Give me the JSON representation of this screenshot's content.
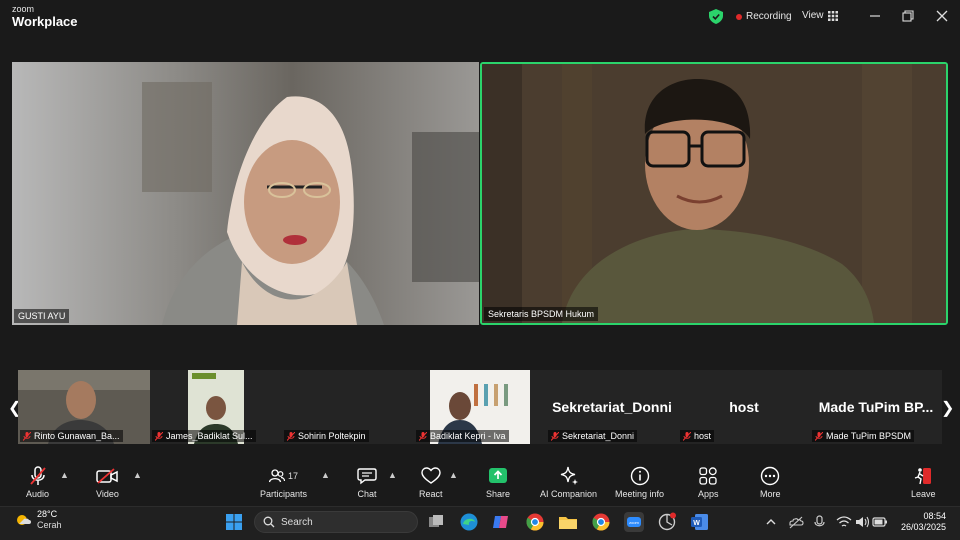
{
  "app": {
    "brand_small": "zoom",
    "brand_big": "Workplace"
  },
  "header": {
    "recording_label": "Recording",
    "view_label": "View"
  },
  "main_videos": [
    {
      "name": "GUSTI AYU"
    },
    {
      "name": "Sekretaris BPSDM Hukum",
      "active_speaker": true
    }
  ],
  "thumbnails": [
    {
      "label": "Rinto Gunawan_Ba..."
    },
    {
      "label": "James_Badiklat Sul..."
    },
    {
      "label": "Sohirin Poltekpin"
    },
    {
      "label": "Badiklat Kepri - Iva"
    },
    {
      "label": "Sekretariat_Donni",
      "big_name": "Sekretariat_Donni"
    },
    {
      "label": "host",
      "big_name": "host"
    },
    {
      "label": "Made TuPim BPSDM",
      "big_name": "Made TuPim BP..."
    }
  ],
  "toolbar": {
    "audio": "Audio",
    "video": "Video",
    "participants": "Participants",
    "participants_count": "17",
    "chat": "Chat",
    "react": "React",
    "share": "Share",
    "ai_companion": "AI Companion",
    "meeting_info": "Meeting info",
    "apps": "Apps",
    "more": "More",
    "leave": "Leave"
  },
  "taskbar": {
    "weather_temp": "28°C",
    "weather_desc": "Cerah",
    "search_placeholder": "Search",
    "time": "08:54",
    "date": "26/03/2025"
  },
  "colors": {
    "accent_green": "#2bd46b",
    "share_green": "#23c26b",
    "leave_red": "#e02a2a",
    "rec_red": "#e02a2a"
  }
}
